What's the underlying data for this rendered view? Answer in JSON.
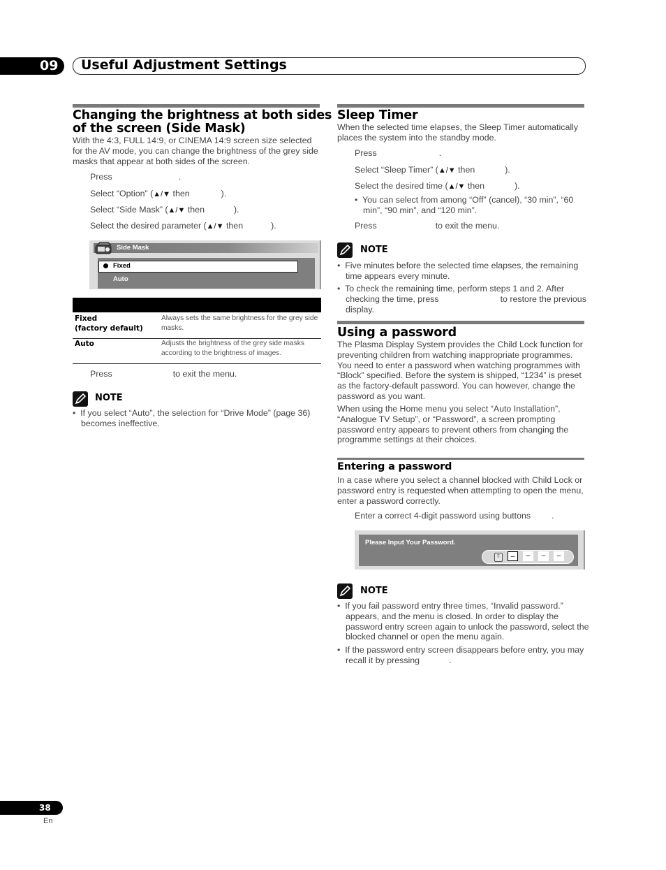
{
  "chapter": {
    "number": "09",
    "title": "Useful Adjustment Settings"
  },
  "side_mask": {
    "title_line1": "Changing the brightness at both sides",
    "title_line2": "of the screen (Side Mask)",
    "intro": "With the 4:3, FULL 14:9, or CINEMA 14:9 screen size selected for the AV mode, you can change the brightness of the grey side masks that appear at both sides of the screen.",
    "steps": [
      {
        "a": "Press",
        "b": "."
      },
      {
        "a": "Select “Option” (",
        "arrows": "▲/▼",
        "then": "then",
        "b": ")."
      },
      {
        "a": "Select “Side Mask” (",
        "arrows": "▲/▼",
        "then": "then",
        "b": ")."
      },
      {
        "a": "Select the desired parameter (",
        "arrows": "▲/▼",
        "then": "then",
        "b": ")."
      }
    ],
    "osd": {
      "header": "Side Mask",
      "options": [
        "Fixed",
        "Auto"
      ],
      "selected": "Fixed",
      "icon": "tv-menu-icon"
    },
    "table": [
      {
        "key_line1": "Fixed",
        "key_line2": "(factory default)",
        "value": "Always sets the same brightness for the grey side masks."
      },
      {
        "key_line1": "Auto",
        "key_line2": "",
        "value": "Adjusts the brightness of the grey side masks according to the brightness of images."
      }
    ],
    "exit_step": {
      "a": "Press",
      "b": "to exit the menu."
    },
    "note_label": "NOTE",
    "notes": [
      "If you select “Auto”, the selection for “Drive Mode” (page 36) becomes ineffective."
    ]
  },
  "sleep_timer": {
    "title": "Sleep Timer",
    "intro": "When the selected time elapses, the Sleep Timer automatically places the system into the standby mode.",
    "steps": [
      {
        "a": "Press",
        "b": "."
      },
      {
        "a": "Select “Sleep Timer” (",
        "arrows": "▲/▼",
        "then": "then",
        "b": ")."
      },
      {
        "a": "Select the desired time (",
        "arrows": "▲/▼",
        "then": "then",
        "b": ")."
      }
    ],
    "sub_bullet": "You can select from among “Off” (cancel), “30 min”, “60 min”, “90 min”, and “120 min”.",
    "exit_step": {
      "a": "Press",
      "b": "to exit the menu."
    },
    "note_label": "NOTE",
    "notes": [
      "Five minutes before the selected time elapses, the remaining time appears every minute.",
      {
        "a": "To check the remaining time, perform steps 1 and 2. After checking the time, press",
        "b": "to restore the previous display."
      }
    ]
  },
  "password": {
    "title": "Using a password",
    "intro1": "The Plasma Display System provides the Child Lock function for preventing children from watching inappropriate programmes. You need to enter a password when watching programmes with “Block” specified. Before the system is shipped, “1234” is preset as the factory-default password. You can however, change the password as you want.",
    "intro2": "When using the Home menu you select “Auto Installation”, “Analogue TV Setup”, or “Password”, a screen prompting password entry appears to prevent others from changing the programme settings at their choices.",
    "entering": {
      "title": "Entering a password",
      "intro": "In a case where you select a channel blocked with Child Lock or password entry is requested when attempting to open the menu, enter a password correctly.",
      "step": {
        "a": "Enter a correct 4-digit password using buttons",
        "b": "."
      },
      "osd": {
        "prompt": "Please Input Your Password.",
        "digits": [
          "–",
          "–",
          "–",
          "–"
        ],
        "keypad_icon": "keypad-icon"
      }
    },
    "note_label": "NOTE",
    "notes": [
      "If you fail password entry three times, “Invalid password.” appears, and the menu is closed. In order to display the password entry screen again to unlock the password, select the blocked channel or open the menu again.",
      {
        "a": "If the password entry screen disappears before entry, you may recall it by pressing",
        "b": "."
      }
    ]
  },
  "footer": {
    "page": "38",
    "lang": "En"
  }
}
